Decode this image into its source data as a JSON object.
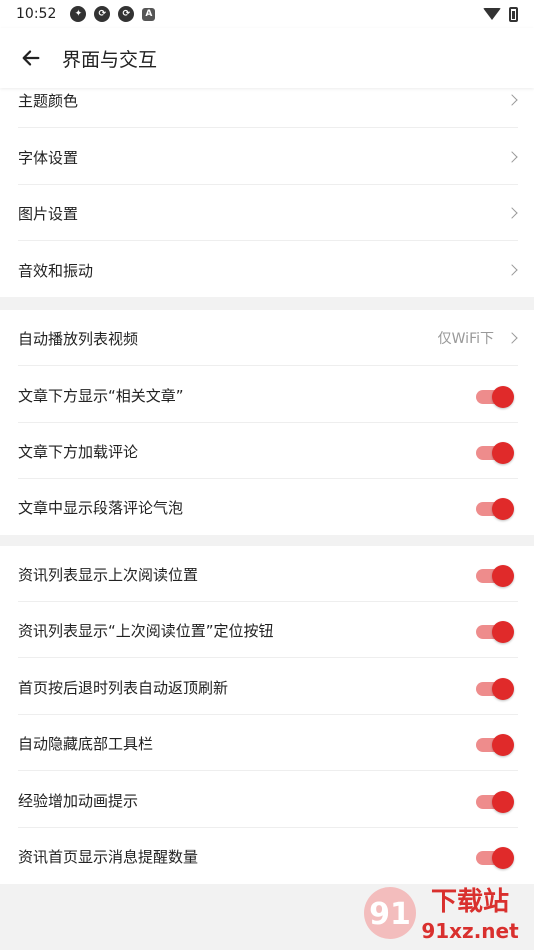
{
  "status_bar": {
    "time": "10:52",
    "icons": [
      "app-icon",
      "sync-icon",
      "sync-icon",
      "a-icon"
    ]
  },
  "header": {
    "title": "界面与交互"
  },
  "sections": [
    {
      "items": [
        {
          "label": "主题颜色",
          "type": "link"
        },
        {
          "label": "字体设置",
          "type": "link"
        },
        {
          "label": "图片设置",
          "type": "link"
        },
        {
          "label": "音效和振动",
          "type": "link"
        }
      ]
    },
    {
      "items": [
        {
          "label": "自动播放列表视频",
          "type": "select",
          "value": "仅WiFi下"
        },
        {
          "label": "文章下方显示“相关文章”",
          "type": "toggle",
          "on": true
        },
        {
          "label": "文章下方加载评论",
          "type": "toggle",
          "on": true
        },
        {
          "label": "文章中显示段落评论气泡",
          "type": "toggle",
          "on": true
        }
      ]
    },
    {
      "items": [
        {
          "label": "资讯列表显示上次阅读位置",
          "type": "toggle",
          "on": true
        },
        {
          "label": "资讯列表显示“上次阅读位置”定位按钮",
          "type": "toggle",
          "on": true
        },
        {
          "label": "首页按后退时列表自动返顶刷新",
          "type": "toggle",
          "on": true
        },
        {
          "label": "自动隐藏底部工具栏",
          "type": "toggle",
          "on": true
        },
        {
          "label": "经验增加动画提示",
          "type": "toggle",
          "on": true
        },
        {
          "label": "资讯首页显示消息提醒数量",
          "type": "toggle",
          "on": true
        }
      ]
    }
  ],
  "colors": {
    "accent": "#e02a2a",
    "toggle_track": "#ee8c8c",
    "background": "#f2f2f2"
  },
  "watermark": {
    "text_top": "下载站",
    "text_bottom": "91xz.net"
  }
}
